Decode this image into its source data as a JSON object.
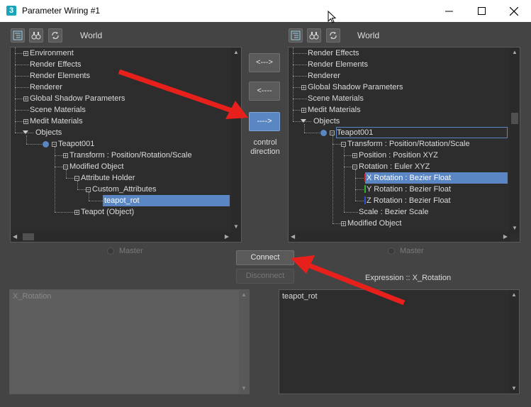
{
  "window": {
    "title": "Parameter Wiring #1",
    "app_icon_text": "3",
    "minimize_icon": "minimize-icon",
    "maximize_icon": "maximize-icon",
    "close_icon": "close-icon"
  },
  "left_panel": {
    "world_label": "World",
    "tree": [
      {
        "label": "Environment"
      },
      {
        "label": "Render Effects"
      },
      {
        "label": "Render Elements"
      },
      {
        "label": "Renderer"
      },
      {
        "label": "Global Shadow Parameters"
      },
      {
        "label": "Scene Materials"
      },
      {
        "label": "Medit Materials"
      },
      {
        "label": "Objects"
      },
      {
        "label": "Teapot001"
      },
      {
        "label": "Transform : Position/Rotation/Scale"
      },
      {
        "label": "Modified Object"
      },
      {
        "label": "Attribute Holder"
      },
      {
        "label": "Custom_Attributes"
      },
      {
        "label": "teapot_rot",
        "selected": true
      },
      {
        "label": "Teapot (Object)"
      }
    ],
    "master_label": "Master"
  },
  "right_panel": {
    "world_label": "World",
    "tree": [
      {
        "label": "Render Effects"
      },
      {
        "label": "Render Elements"
      },
      {
        "label": "Renderer"
      },
      {
        "label": "Global Shadow Parameters"
      },
      {
        "label": "Scene Materials"
      },
      {
        "label": "Medit Materials"
      },
      {
        "label": "Objects"
      },
      {
        "label": "Teapot001"
      },
      {
        "label": "Transform : Position/Rotation/Scale"
      },
      {
        "label": "Position : Position XYZ"
      },
      {
        "label": "Rotation : Euler XYZ"
      },
      {
        "label": "X Rotation : Bezier Float",
        "selected": true
      },
      {
        "label": "Y Rotation : Bezier Float"
      },
      {
        "label": "Z Rotation : Bezier Float"
      },
      {
        "label": "Scale : Bezier Scale"
      },
      {
        "label": "Modified Object"
      }
    ],
    "master_label": "Master",
    "expression_label": "Expression :: X_Rotation"
  },
  "direction": {
    "both_label": "<--->",
    "left_label": "<----",
    "right_label": "---->",
    "control_label": "control direction"
  },
  "buttons": {
    "connect": "Connect",
    "disconnect": "Disconnect"
  },
  "left_expression": "X_Rotation",
  "right_expression": "teapot_rot",
  "colors": {
    "selection": "#5b86c4",
    "annotation_arrow": "#e8201c",
    "x_axis": "#d23030",
    "y_axis": "#30b030",
    "z_axis": "#3050d0"
  }
}
